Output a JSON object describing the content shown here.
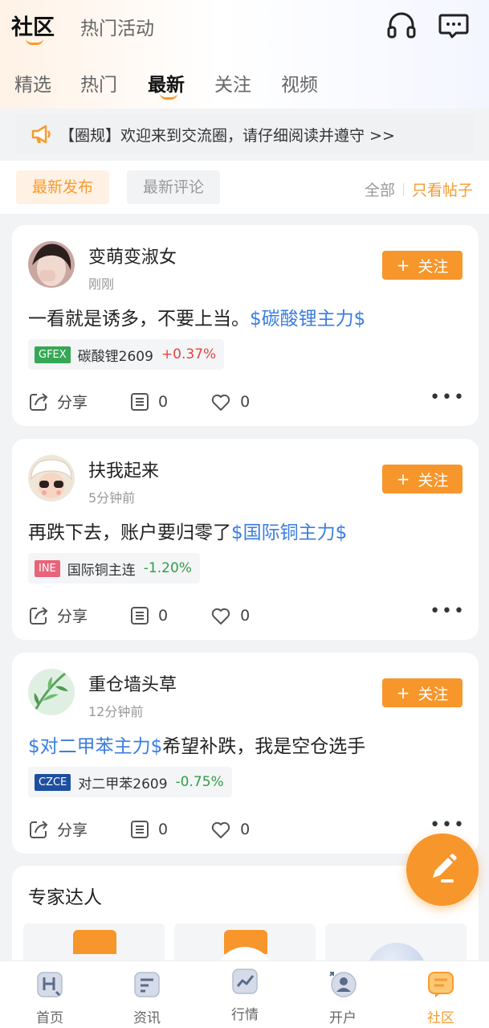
{
  "header": {
    "tabs": [
      {
        "label": "社区",
        "active": true
      },
      {
        "label": "热门活动",
        "active": false
      }
    ],
    "icons": [
      "headset-icon",
      "message-icon"
    ]
  },
  "sub_tabs": [
    {
      "label": "精选",
      "active": false
    },
    {
      "label": "热门",
      "active": false
    },
    {
      "label": "最新",
      "active": true
    },
    {
      "label": "关注",
      "active": false
    },
    {
      "label": "视频",
      "active": false
    }
  ],
  "notice": {
    "text": "【圈规】欢迎来到交流圈，请仔细阅读并遵守 >>",
    "icon": "megaphone-icon"
  },
  "filters": {
    "chips": [
      {
        "label": "最新发布",
        "active": true
      },
      {
        "label": "最新评论",
        "active": false
      }
    ],
    "all_label": "全部",
    "only_posts_label": "只看帖子"
  },
  "follow_label": "关注",
  "posts": [
    {
      "username": "变萌变淑女",
      "time": "刚刚",
      "content_pre": "一看就是诱多，不要上当。",
      "content_tag": "$碳酸锂主力$",
      "content_post": "",
      "quote": {
        "exchange": "GFEX",
        "exchange_color": "#35a853",
        "name": "碳酸锂2609",
        "change": "+0.37%",
        "direction": "up"
      },
      "share_label": "分享",
      "comments": "0",
      "likes": "0"
    },
    {
      "username": "扶我起来",
      "time": "5分钟前",
      "content_pre": "再跌下去，账户要归零了",
      "content_tag": "$国际铜主力$",
      "content_post": "",
      "quote": {
        "exchange": "INE",
        "exchange_color": "#e8647a",
        "name": "国际铜主连",
        "change": "-1.20%",
        "direction": "down"
      },
      "share_label": "分享",
      "comments": "0",
      "likes": "0"
    },
    {
      "username": "重仓墙头草",
      "time": "12分钟前",
      "content_pre": "",
      "content_tag": "$对二甲苯主力$",
      "content_post": "希望补跌，我是空仓选手",
      "quote": {
        "exchange": "CZCE",
        "exchange_color": "#1d4fa0",
        "name": "对二甲苯2609",
        "change": "-0.75%",
        "direction": "down"
      },
      "share_label": "分享",
      "comments": "0",
      "likes": "0"
    }
  ],
  "expert_section": {
    "title": "专家达人"
  },
  "bottom_tabs": [
    {
      "label": "首页",
      "icon": "home-icon",
      "active": false
    },
    {
      "label": "资讯",
      "icon": "news-icon",
      "active": false
    },
    {
      "label": "行情",
      "icon": "chart-icon",
      "active": false
    },
    {
      "label": "开户",
      "icon": "account-icon",
      "active": false
    },
    {
      "label": "社区",
      "icon": "community-icon",
      "active": true
    }
  ],
  "colors": {
    "accent": "#f7962a",
    "link": "#3b7de0",
    "up": "#e5443f",
    "down": "#2f9e44"
  }
}
